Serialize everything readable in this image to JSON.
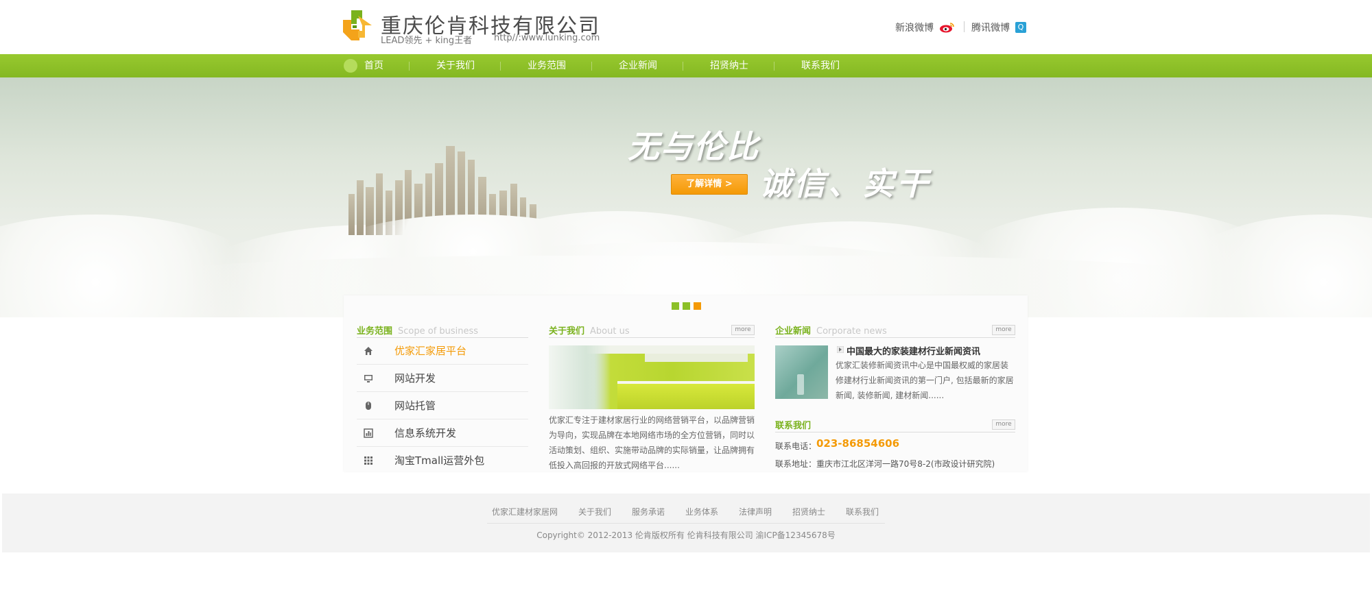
{
  "header": {
    "company_name": "重庆伦肯科技有限公司",
    "slogan": "LEAD领先 + king王者",
    "url": "http//:www.lunking.com",
    "sina_weibo": "新浪微博",
    "tencent_weibo": "腾讯微博"
  },
  "nav": {
    "items": [
      "首页",
      "关于我们",
      "业务范围",
      "企业新闻",
      "招贤纳士",
      "联系我们"
    ]
  },
  "banner": {
    "slogan_line1": "无与伦比",
    "slogan_line2": "诚信、实干",
    "detail_button": "了解详情  >",
    "slide_count": 3,
    "active_slide": 3
  },
  "services": {
    "title": "业务范围",
    "title_en": "Scope of business",
    "items": [
      {
        "label": "优家汇家居平台",
        "icon": "home-icon"
      },
      {
        "label": "网站开发",
        "icon": "monitor-icon"
      },
      {
        "label": "网站托管",
        "icon": "mouse-icon"
      },
      {
        "label": "信息系统开发",
        "icon": "chart-icon"
      },
      {
        "label": "淘宝Tmall运营外包",
        "icon": "grid-icon"
      }
    ]
  },
  "about": {
    "title": "关于我们",
    "title_en": "About us",
    "more": "more",
    "text": "优家汇专注于建材家居行业的网络营销平台，以品牌营销为导向，实现品牌在本地网络市场的全方位营销，同时以活动策划、组织、实施带动品牌的实际销量，让品牌拥有低投入高回报的开放式网络平台......"
  },
  "news": {
    "title": "企业新闻",
    "title_en": "Corporate news",
    "more": "more",
    "headline": "中国最大的家装建材行业新闻资讯",
    "summary": "优家汇装修新闻资讯中心是中国最权威的家居装修建材行业新闻资讯的第一门户, 包括最新的家居新闻, 装修新闻, 建材新闻......"
  },
  "contact": {
    "title": "联系我们",
    "more": "more",
    "phone_label": "联系电话：",
    "phone": "023-86854606",
    "address": "联系地址：重庆市江北区洋河一路70号8-2(市政设计研究院)"
  },
  "footer": {
    "links": [
      "优家汇建材家居网",
      "关于我们",
      "服务承诺",
      "业务体系",
      "法律声明",
      "招贤纳士",
      "联系我们"
    ],
    "copyright": "Copyright© 2012-2013 伦肯版权所有 伦肯科技有限公司 渝ICP备12345678号"
  },
  "colors": {
    "nav_green": "#8cc028",
    "accent_orange": "#f49a06",
    "section_title_green": "#7ab21d"
  }
}
